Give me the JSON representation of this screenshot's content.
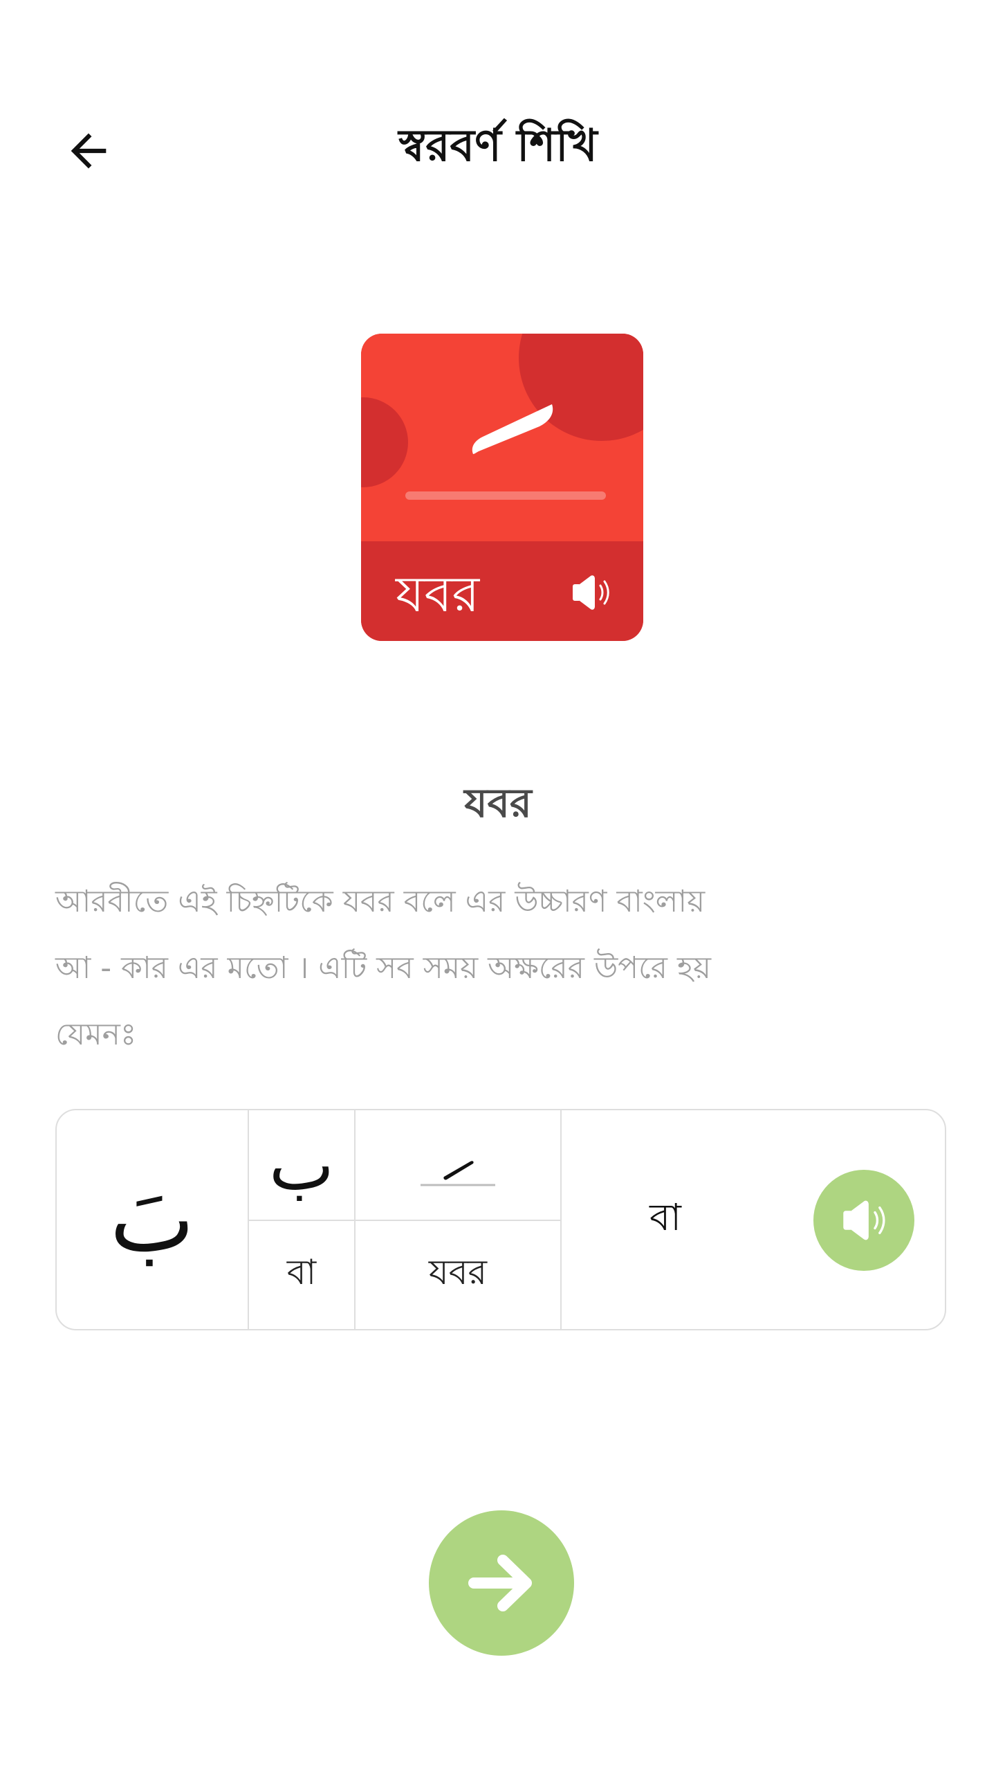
{
  "header": {
    "title": "স্বরবর্ণ শিখি",
    "back_icon": "arrow-left-icon"
  },
  "card": {
    "mark": "َ",
    "name": "যবর",
    "sound_icon": "speaker-icon",
    "colors": {
      "top": "#f44336",
      "bottom": "#d32f2f"
    }
  },
  "lesson": {
    "title": "যবর",
    "description_lines": [
      "আরবীতে এই চিহ্নটিকে যবর বলে এর উচ্চারণ বাংলায়",
      "আ - কার এর মতো । এটি সব সময় অক্ষরের উপরে হয়",
      "যেমনঃ"
    ]
  },
  "example": {
    "combined": "بَ",
    "letter": "ب",
    "letter_name": "বা",
    "mark": "َ",
    "mark_name": "যবর",
    "result": "বা",
    "sound_icon": "speaker-icon"
  },
  "next_button": {
    "icon": "arrow-right-icon",
    "color": "#aed581"
  }
}
